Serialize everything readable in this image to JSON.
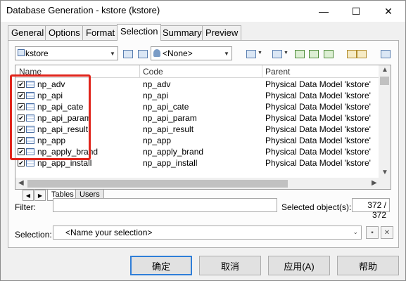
{
  "window": {
    "title": "Database Generation - kstore (kstore)",
    "controls": {
      "minimize": "—",
      "maximize": "☐",
      "close": "✕"
    }
  },
  "tabs": [
    {
      "label": "General"
    },
    {
      "label": "Options"
    },
    {
      "label": "Format"
    },
    {
      "label": "Selection",
      "active": true
    },
    {
      "label": "Summary"
    },
    {
      "label": "Preview"
    }
  ],
  "toolbar": {
    "model_selector": "kstore",
    "owner_selector": "<None>"
  },
  "grid": {
    "columns": [
      "Name",
      "Code",
      "Parent"
    ],
    "rows": [
      {
        "name": "np_adv",
        "code": "np_adv",
        "parent": "Physical Data Model 'kstore'",
        "checked": true
      },
      {
        "name": "np_api",
        "code": "np_api",
        "parent": "Physical Data Model 'kstore'",
        "checked": true
      },
      {
        "name": "np_api_cate",
        "code": "np_api_cate",
        "parent": "Physical Data Model 'kstore'",
        "checked": true
      },
      {
        "name": "np_api_param",
        "code": "np_api_param",
        "parent": "Physical Data Model 'kstore'",
        "checked": true
      },
      {
        "name": "np_api_result",
        "code": "np_api_result",
        "parent": "Physical Data Model 'kstore'",
        "checked": true
      },
      {
        "name": "np_app",
        "code": "np_app",
        "parent": "Physical Data Model 'kstore'",
        "checked": true
      },
      {
        "name": "np_apply_brand",
        "code": "np_apply_brand",
        "parent": "Physical Data Model 'kstore'",
        "checked": true
      },
      {
        "name": "np_app_install",
        "code": "np_app_install",
        "parent": "Physical Data Model 'kstore'",
        "checked": true
      }
    ]
  },
  "sheet_tabs": [
    "Tables",
    "Users"
  ],
  "filter": {
    "label": "Filter:",
    "value": "",
    "selected_label": "Selected object(s):",
    "selected_count": "372 / 372"
  },
  "selection": {
    "label": "Selection:",
    "placeholder": "<Name your selection>"
  },
  "buttons": {
    "ok": "确定",
    "cancel": "取消",
    "apply": "应用(A)",
    "help": "帮助"
  },
  "colors": {
    "highlight": "#e0241b",
    "default_button_border": "#2f7ed8"
  }
}
